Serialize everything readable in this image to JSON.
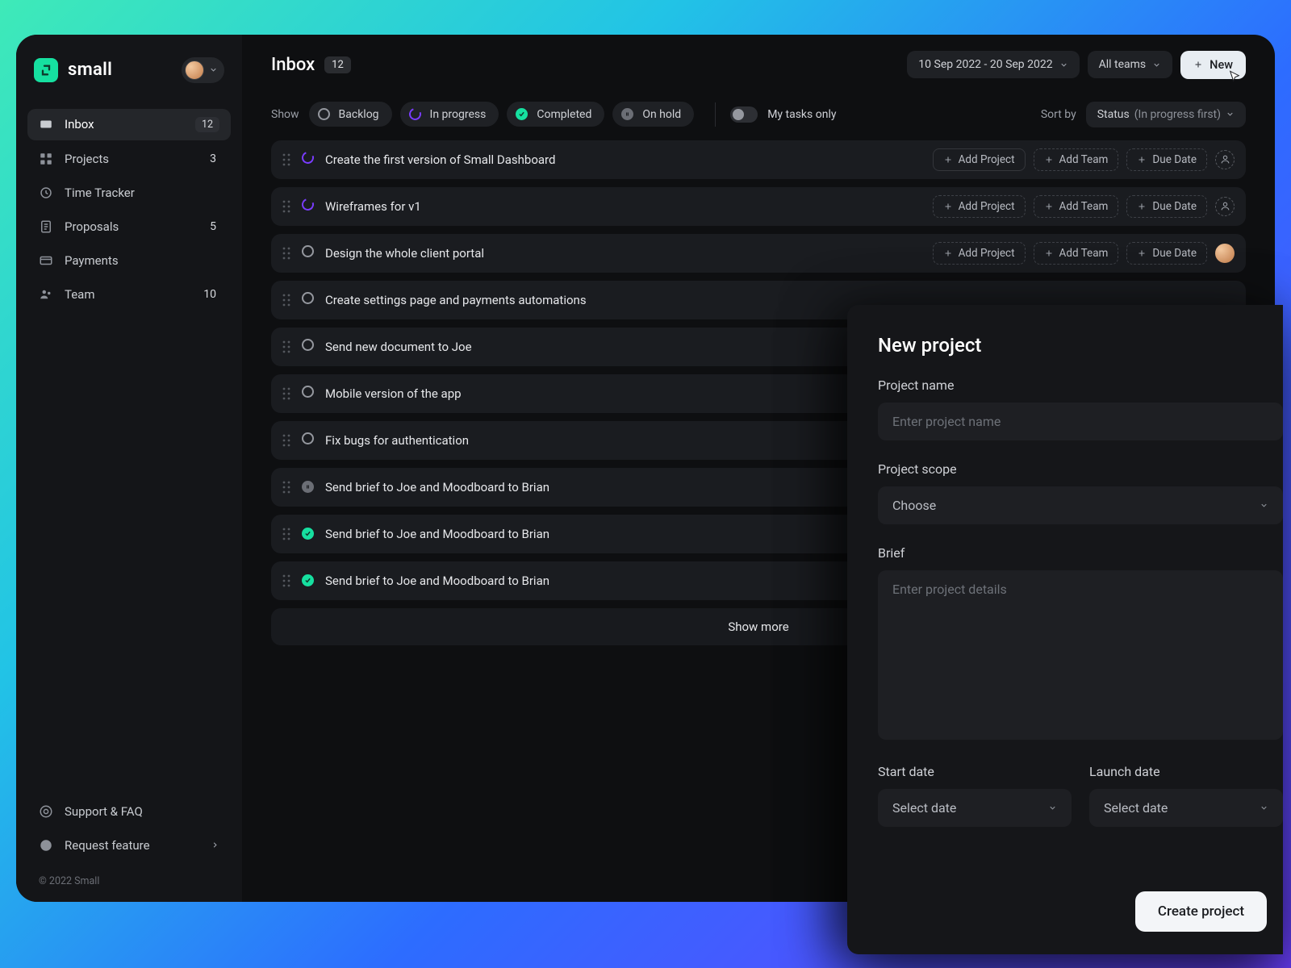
{
  "brand": {
    "name": "small"
  },
  "sidebar": {
    "items": [
      {
        "label": "Inbox",
        "count": "12",
        "active": true
      },
      {
        "label": "Projects",
        "count": "3"
      },
      {
        "label": "Time Tracker"
      },
      {
        "label": "Proposals",
        "count": "5"
      },
      {
        "label": "Payments"
      },
      {
        "label": "Team",
        "count": "10"
      }
    ],
    "support": "Support & FAQ",
    "request": "Request feature",
    "copyright": "© 2022 Small"
  },
  "header": {
    "title": "Inbox",
    "badge": "12",
    "dateRange": "10 Sep 2022 -  20 Sep 2022",
    "teamFilter": "All teams",
    "newButton": "New"
  },
  "filters": {
    "showLabel": "Show",
    "chips": {
      "backlog": "Backlog",
      "progress": "In progress",
      "completed": "Completed",
      "hold": "On hold"
    },
    "myTasks": "My tasks only",
    "sortBy": "Sort by",
    "sortValue": "Status",
    "sortHint": "(In progress first)"
  },
  "taskActions": {
    "addProject": "Add Project",
    "addTeam": "Add Team",
    "dueDate": "Due Date"
  },
  "tasks": [
    {
      "title": "Create the first version of Small Dashboard",
      "status": "progress",
      "actions": true,
      "avatar": "empty"
    },
    {
      "title": "Wireframes for v1",
      "status": "progress",
      "actions": true,
      "avatar": "empty"
    },
    {
      "title": "Design the whole client portal",
      "status": "backlog",
      "actions": true,
      "avatar": "user"
    },
    {
      "title": "Create settings page and payments automations",
      "status": "backlog"
    },
    {
      "title": "Send new document to Joe",
      "status": "backlog"
    },
    {
      "title": "Mobile version of the app",
      "status": "backlog"
    },
    {
      "title": "Fix bugs for authentication",
      "status": "backlog"
    },
    {
      "title": "Send brief to Joe and Moodboard to Brian",
      "status": "hold"
    },
    {
      "title": "Send brief to Joe and Moodboard to Brian",
      "status": "done"
    },
    {
      "title": "Send brief to Joe and Moodboard to Brian",
      "status": "done"
    }
  ],
  "showMore": "Show more",
  "panel": {
    "title": "New project",
    "name": {
      "label": "Project name",
      "placeholder": "Enter project name"
    },
    "scope": {
      "label": "Project scope",
      "value": "Choose"
    },
    "brief": {
      "label": "Brief",
      "placeholder": "Enter project details"
    },
    "start": {
      "label": "Start date",
      "value": "Select date"
    },
    "launch": {
      "label": "Launch date",
      "value": "Select date"
    },
    "create": "Create project"
  }
}
